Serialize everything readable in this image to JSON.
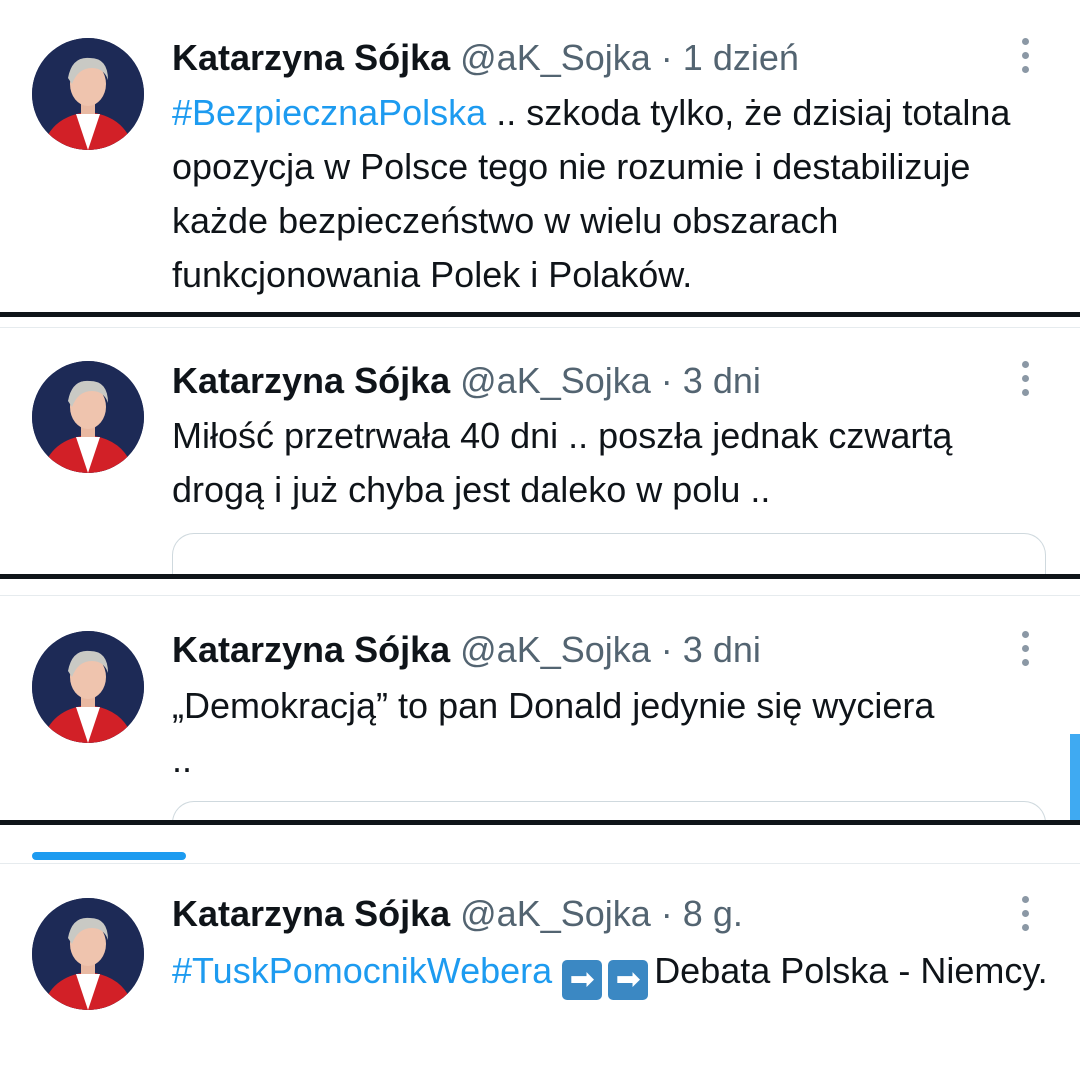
{
  "tweets": [
    {
      "name": "Katarzyna Sójka",
      "handle": "@aK_Sojka",
      "sep": " · ",
      "time": "1 dzień",
      "hashtag": "#BezpiecznaPolska",
      "text": " .. szkoda tylko, że dzisiaj totalna opozycja w Polsce tego nie rozumie i destabilizuje każde bezpieczeństwo w wielu obszarach funkcjonowania Polek i Polaków."
    },
    {
      "name": "Katarzyna Sójka",
      "handle": "@aK_Sojka",
      "sep": " · ",
      "time": "3 dni",
      "text": "Miłość przetrwała 40 dni .. poszła jednak czwartą drogą i już chyba jest daleko w polu .."
    },
    {
      "name": "Katarzyna Sójka",
      "handle": "@aK_Sojka",
      "sep": " · ",
      "time": "3 dni",
      "text": "„Demokracją” to pan Donald jedynie się wyciera .."
    },
    {
      "name": "Katarzyna Sójka",
      "handle": "@aK_Sojka",
      "sep": " · ",
      "time": "8 g.",
      "hashtag": "#TuskPomocnikWebera",
      "arrow": "➡",
      "text": "Debata Polska - Niemcy."
    }
  ],
  "icons": {
    "more": "more-vertical-icon",
    "arrow": "right-arrow-emoji-icon"
  },
  "colors": {
    "hashtag": "#1d9bf0",
    "secondary_text": "#536471",
    "accent_bar": "#1d9bf0"
  }
}
